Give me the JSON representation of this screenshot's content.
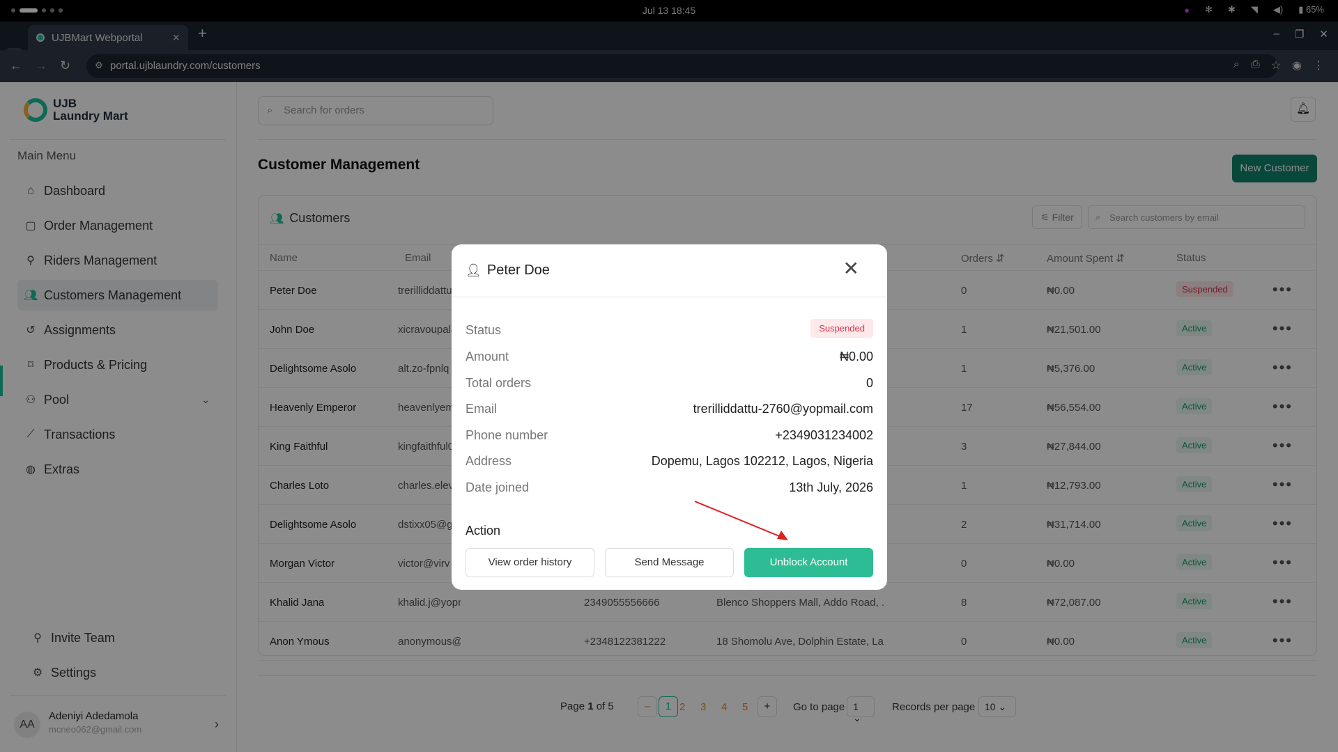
{
  "os": {
    "clock": "Jul 13  18:45",
    "battery": "65%"
  },
  "browser": {
    "tab_title": "UJBMart Webportal",
    "url": "portal.ujblaundry.com/customers"
  },
  "sidebar": {
    "logo_line1": "UJB",
    "logo_line2": "Laundry Mart",
    "menu_title": "Main Menu",
    "items": [
      {
        "label": "Dashboard",
        "icon": "home-icon"
      },
      {
        "label": "Order Management",
        "icon": "bag-icon"
      },
      {
        "label": "Riders Management",
        "icon": "bike-icon"
      },
      {
        "label": "Customers Management",
        "icon": "users-icon",
        "active": true
      },
      {
        "label": "Assignments",
        "icon": "history-icon"
      },
      {
        "label": "Products & Pricing",
        "icon": "tags-icon"
      },
      {
        "label": "Pool",
        "icon": "pool-icon"
      },
      {
        "label": "Transactions",
        "icon": "chart-icon"
      },
      {
        "label": "Extras",
        "icon": "globe-icon"
      }
    ],
    "bottom_items": [
      {
        "label": "Invite Team",
        "icon": "user-plus-icon"
      },
      {
        "label": "Settings",
        "icon": "gear-icon"
      }
    ],
    "user": {
      "initials": "AA",
      "name": "Adeniyi Adedamola",
      "email": "mcneo062@gmail.com"
    }
  },
  "header": {
    "search_placeholder": "Search for orders"
  },
  "page": {
    "title": "Customer Management",
    "new_button": "New Customer"
  },
  "customers": {
    "card_title": "Customers",
    "filter_label": "Filter",
    "search_placeholder": "Search customers by email",
    "columns": [
      "Name",
      "Email",
      "Orders",
      "Amount Spent",
      "Status"
    ],
    "rows": [
      {
        "name": "Peter Doe",
        "email": "trerilliddattu",
        "phone": "",
        "address": "",
        "orders": "0",
        "amount": "₦0.00",
        "status": "Suspended"
      },
      {
        "name": "John Doe",
        "email": "xicravoupala",
        "phone": "",
        "address": "",
        "orders": "1",
        "amount": "₦21,501.00",
        "status": "Active"
      },
      {
        "name": "Delightsome Asolo",
        "email": "alt.zo-fpnlq",
        "phone": "",
        "address": "",
        "orders": "1",
        "amount": "₦5,376.00",
        "status": "Active"
      },
      {
        "name": "Heavenly Emperor",
        "email": "heavenlyem",
        "phone": "",
        "address": "",
        "orders": "17",
        "amount": "₦56,554.00",
        "status": "Active"
      },
      {
        "name": "King Faithful",
        "email": "kingfaithful0",
        "phone": "",
        "address": "",
        "orders": "3",
        "amount": "₦27,844.00",
        "status": "Active"
      },
      {
        "name": "Charles Loto",
        "email": "charles.elev",
        "phone": "",
        "address": "",
        "orders": "1",
        "amount": "₦12,793.00",
        "status": "Active"
      },
      {
        "name": "Delightsome Asolo",
        "email": "dstixx05@g",
        "phone": "",
        "address": "",
        "orders": "2",
        "amount": "₦31,714.00",
        "status": "Active"
      },
      {
        "name": "Morgan Victor",
        "email": "victor@virv",
        "phone": "",
        "address": "",
        "orders": "0",
        "amount": "₦0.00",
        "status": "Active"
      },
      {
        "name": "Khalid Jana",
        "email": "khalid.j@yopmail.com",
        "phone": "2349055556666",
        "address": "Blenco Shoppers Mall, Addo Road, ...",
        "orders": "8",
        "amount": "₦72,087.00",
        "status": "Active"
      },
      {
        "name": "Anon Ymous",
        "email": "anonymous@yop.mail",
        "phone": "+2348122381222",
        "address": "18 Shomolu Ave, Dolphin Estate, La...",
        "orders": "0",
        "amount": "₦0.00",
        "status": "Active"
      }
    ]
  },
  "pagination": {
    "page_label": "Page",
    "current": "1",
    "of_label": "of 5",
    "pages": [
      "1",
      "2",
      "3",
      "4",
      "5"
    ],
    "goto_label": "Go to page",
    "goto_value": "1",
    "records_label": "Records per page",
    "records_value": "10"
  },
  "modal": {
    "title": "Peter Doe",
    "fields": [
      {
        "label": "Status",
        "value": "Suspended"
      },
      {
        "label": "Amount",
        "value": "₦0.00"
      },
      {
        "label": "Total orders",
        "value": "0"
      },
      {
        "label": "Email",
        "value": "trerilliddattu-2760@yopmail.com"
      },
      {
        "label": "Phone number",
        "value": "+2349031234002"
      },
      {
        "label": "Address",
        "value": "Dopemu, Lagos 102212, Lagos, Nigeria"
      },
      {
        "label": "Date joined",
        "value": "13th July, 2026"
      }
    ],
    "action_title": "Action",
    "buttons": {
      "history": "View order history",
      "message": "Send Message",
      "unblock": "Unblock Account"
    }
  },
  "colors": {
    "accent": "#1dbf9a",
    "primary_button": "#10836c",
    "suspended": "#d6334b",
    "active": "#1c9b68"
  }
}
